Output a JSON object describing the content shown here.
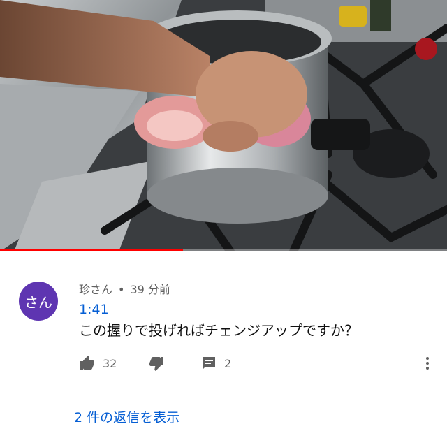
{
  "video": {
    "progress_fraction": 0.41,
    "progress_color": "#ff0000"
  },
  "comment": {
    "avatar_text": "さん",
    "avatar_color": "#5e35b1",
    "author": "珍さん",
    "separator": "•",
    "posted": "39 分前",
    "timestamp_link": "1:41",
    "text": "この握りで投げればチェンジアップですか？",
    "likes": "32",
    "replies_count": "2",
    "view_replies": "2 件の返信を表示"
  },
  "icons": {
    "like": "thumbs-up-icon",
    "dislike": "thumbs-down-icon",
    "reply": "comment-icon",
    "more": "more-vert-icon"
  }
}
